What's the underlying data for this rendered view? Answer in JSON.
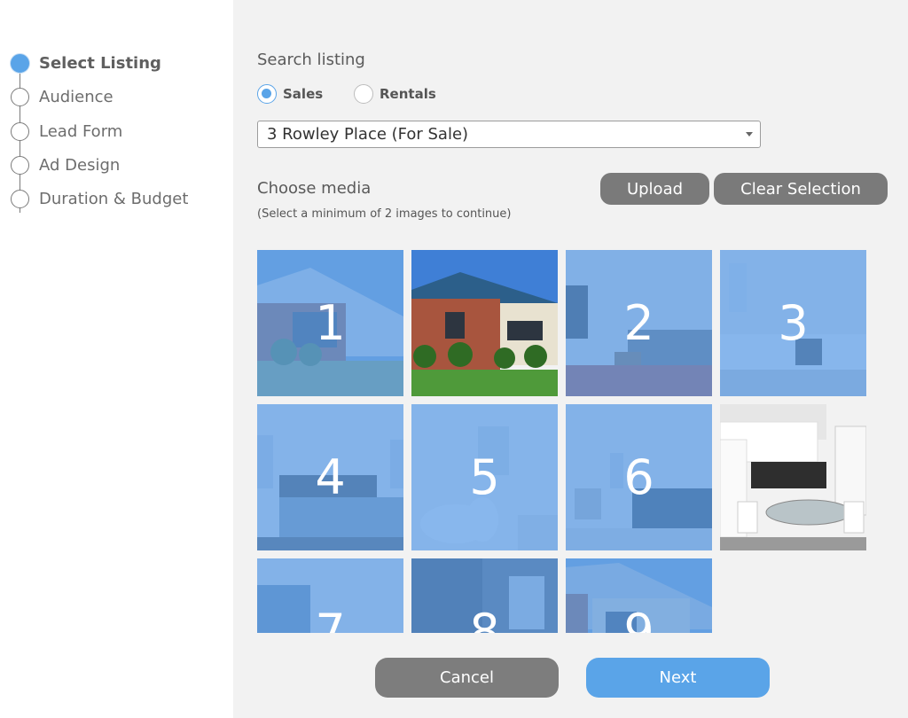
{
  "steps": [
    {
      "label": "Select Listing",
      "active": true
    },
    {
      "label": "Audience",
      "active": false
    },
    {
      "label": "Lead Form",
      "active": false
    },
    {
      "label": "Ad Design",
      "active": false
    },
    {
      "label": "Duration & Budget",
      "active": false
    }
  ],
  "search": {
    "title": "Search listing",
    "radio_sales": "Sales",
    "radio_rentals": "Rentals",
    "selected_type": "Sales",
    "listing_value": "3 Rowley Place (For Sale)"
  },
  "media": {
    "title": "Choose media",
    "hint": "(Select a minimum of 2 images to continue)",
    "upload_label": "Upload",
    "clear_label": "Clear Selection",
    "tiles": [
      {
        "number": "1",
        "selected": true,
        "scene": "house-exterior"
      },
      {
        "number": "",
        "selected": false,
        "scene": "house-exterior"
      },
      {
        "number": "2",
        "selected": true,
        "scene": "living-room"
      },
      {
        "number": "3",
        "selected": true,
        "scene": "kitchen"
      },
      {
        "number": "4",
        "selected": true,
        "scene": "bedroom"
      },
      {
        "number": "5",
        "selected": true,
        "scene": "bathroom"
      },
      {
        "number": "6",
        "selected": true,
        "scene": "living-room"
      },
      {
        "number": "",
        "selected": false,
        "scene": "kitchen-dining"
      },
      {
        "number": "7",
        "selected": true,
        "scene": "room"
      },
      {
        "number": "8",
        "selected": true,
        "scene": "shower"
      },
      {
        "number": "9",
        "selected": true,
        "scene": "house-exterior"
      }
    ]
  },
  "actions": {
    "cancel_label": "Cancel",
    "next_label": "Next"
  },
  "colors": {
    "accent": "#5aa4e8",
    "button_gray": "#7a7a7a",
    "panel_bg": "#f2f2f2"
  }
}
